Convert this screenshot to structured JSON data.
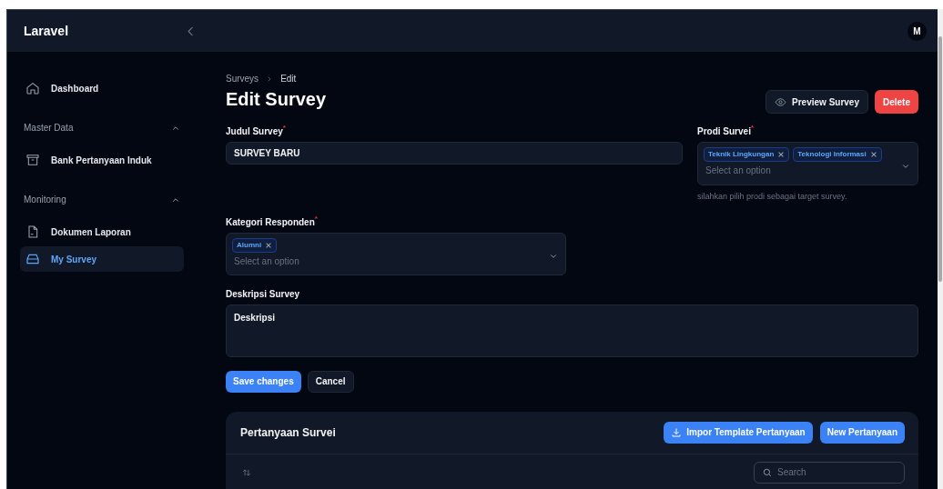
{
  "topbar": {
    "brand": "Laravel",
    "avatar": "M"
  },
  "sidebar": {
    "groups": [
      {
        "items": [
          {
            "label": "Dashboard",
            "selected": false
          }
        ]
      },
      {
        "label": "Master Data",
        "expanded": true,
        "items": [
          {
            "label": "Bank Pertanyaan Induk",
            "selected": false
          }
        ]
      },
      {
        "label": "Monitoring",
        "expanded": true,
        "items": [
          {
            "label": "Dokumen Laporan",
            "selected": false
          },
          {
            "label": "My Survey",
            "selected": true
          }
        ]
      }
    ]
  },
  "breadcrumbs": [
    "Surveys",
    "Edit"
  ],
  "title": "Edit Survey",
  "header_actions": [
    {
      "label": "Preview Survey",
      "kind": "secondary"
    },
    {
      "label": "Delete",
      "kind": "danger"
    }
  ],
  "form": {
    "title_field": {
      "label": "Judul Survey",
      "required_mark": "*",
      "value": "SURVEY BARU"
    },
    "prodi_field": {
      "label": "Prodi Survei",
      "required_mark": "*",
      "tags": [
        "Teknik Lingkungan",
        "Teknologi Informasi"
      ],
      "placeholder": "Select an option",
      "helper": "silahkan pilih prodi sebagai target survey."
    },
    "kategori_field": {
      "label": "Kategori Responden",
      "required_mark": "*",
      "tags": [
        "Alumni"
      ],
      "placeholder": "Select an option"
    },
    "deskripsi_field": {
      "label": "Deskripsi Survey",
      "value": "Deskripsi"
    },
    "actions": [
      {
        "label": "Save changes",
        "kind": "primary"
      },
      {
        "label": "Cancel",
        "kind": "secondary"
      }
    ]
  },
  "questions": {
    "title": "Pertanyaan Survei",
    "actions": [
      {
        "label": "Impor Template Pertanyaan",
        "kind": "import"
      },
      {
        "label": "New Pertanyaan",
        "kind": "primary"
      }
    ],
    "search": {
      "placeholder": "Search"
    }
  }
}
